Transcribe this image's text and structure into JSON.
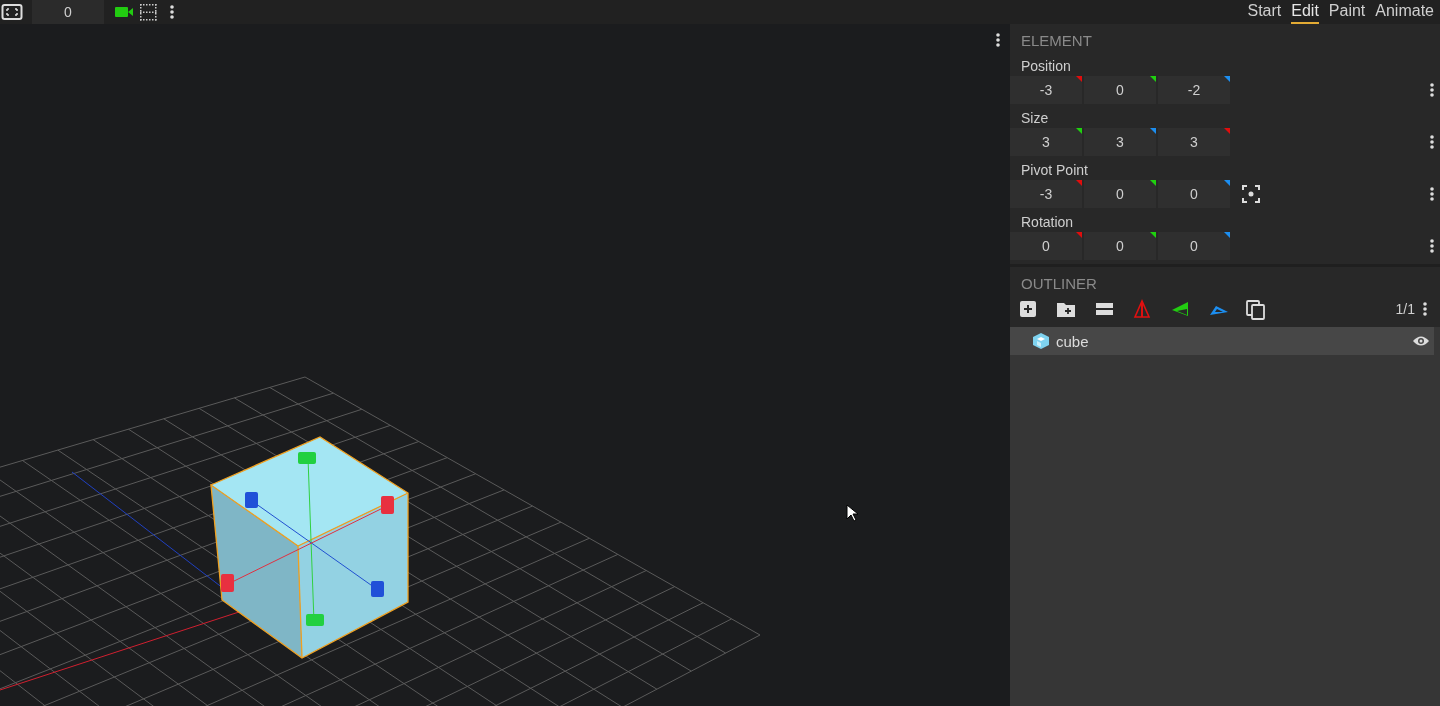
{
  "toolbar": {
    "frame_value": "0",
    "camera_active": true
  },
  "mode_tabs": [
    {
      "label": "Start",
      "selected": false
    },
    {
      "label": "Edit",
      "selected": true
    },
    {
      "label": "Paint",
      "selected": false
    },
    {
      "label": "Animate",
      "selected": false
    }
  ],
  "element_panel": {
    "title": "ELEMENT",
    "rows": [
      {
        "label": "Position",
        "kind": "vector",
        "fields": [
          {
            "value": "-3",
            "color": "#e00d0d"
          },
          {
            "value": "0",
            "color": "#1fd10f"
          },
          {
            "value": "-2",
            "color": "#1c8ef0"
          }
        ]
      },
      {
        "label": "Size",
        "kind": "vector",
        "fields": [
          {
            "value": "3",
            "color": "#1fd10f"
          },
          {
            "value": "3",
            "color": "#1c8ef0"
          },
          {
            "value": "3",
            "color": "#e00d0d"
          }
        ]
      },
      {
        "label": "Pivot Point",
        "kind": "vector_center",
        "fields": [
          {
            "value": "-3",
            "color": "#e00d0d"
          },
          {
            "value": "0",
            "color": "#1fd10f"
          },
          {
            "value": "0",
            "color": "#1c8ef0"
          }
        ]
      },
      {
        "label": "Rotation",
        "kind": "vector",
        "fields": [
          {
            "value": "0",
            "color": "#e00d0d"
          },
          {
            "value": "0",
            "color": "#1fd10f"
          },
          {
            "value": "0",
            "color": "#1c8ef0"
          }
        ]
      }
    ]
  },
  "outliner": {
    "title": "OUTLINER",
    "count": "1/1",
    "items": [
      {
        "name": "cube",
        "selected": true,
        "visible": true
      }
    ]
  }
}
